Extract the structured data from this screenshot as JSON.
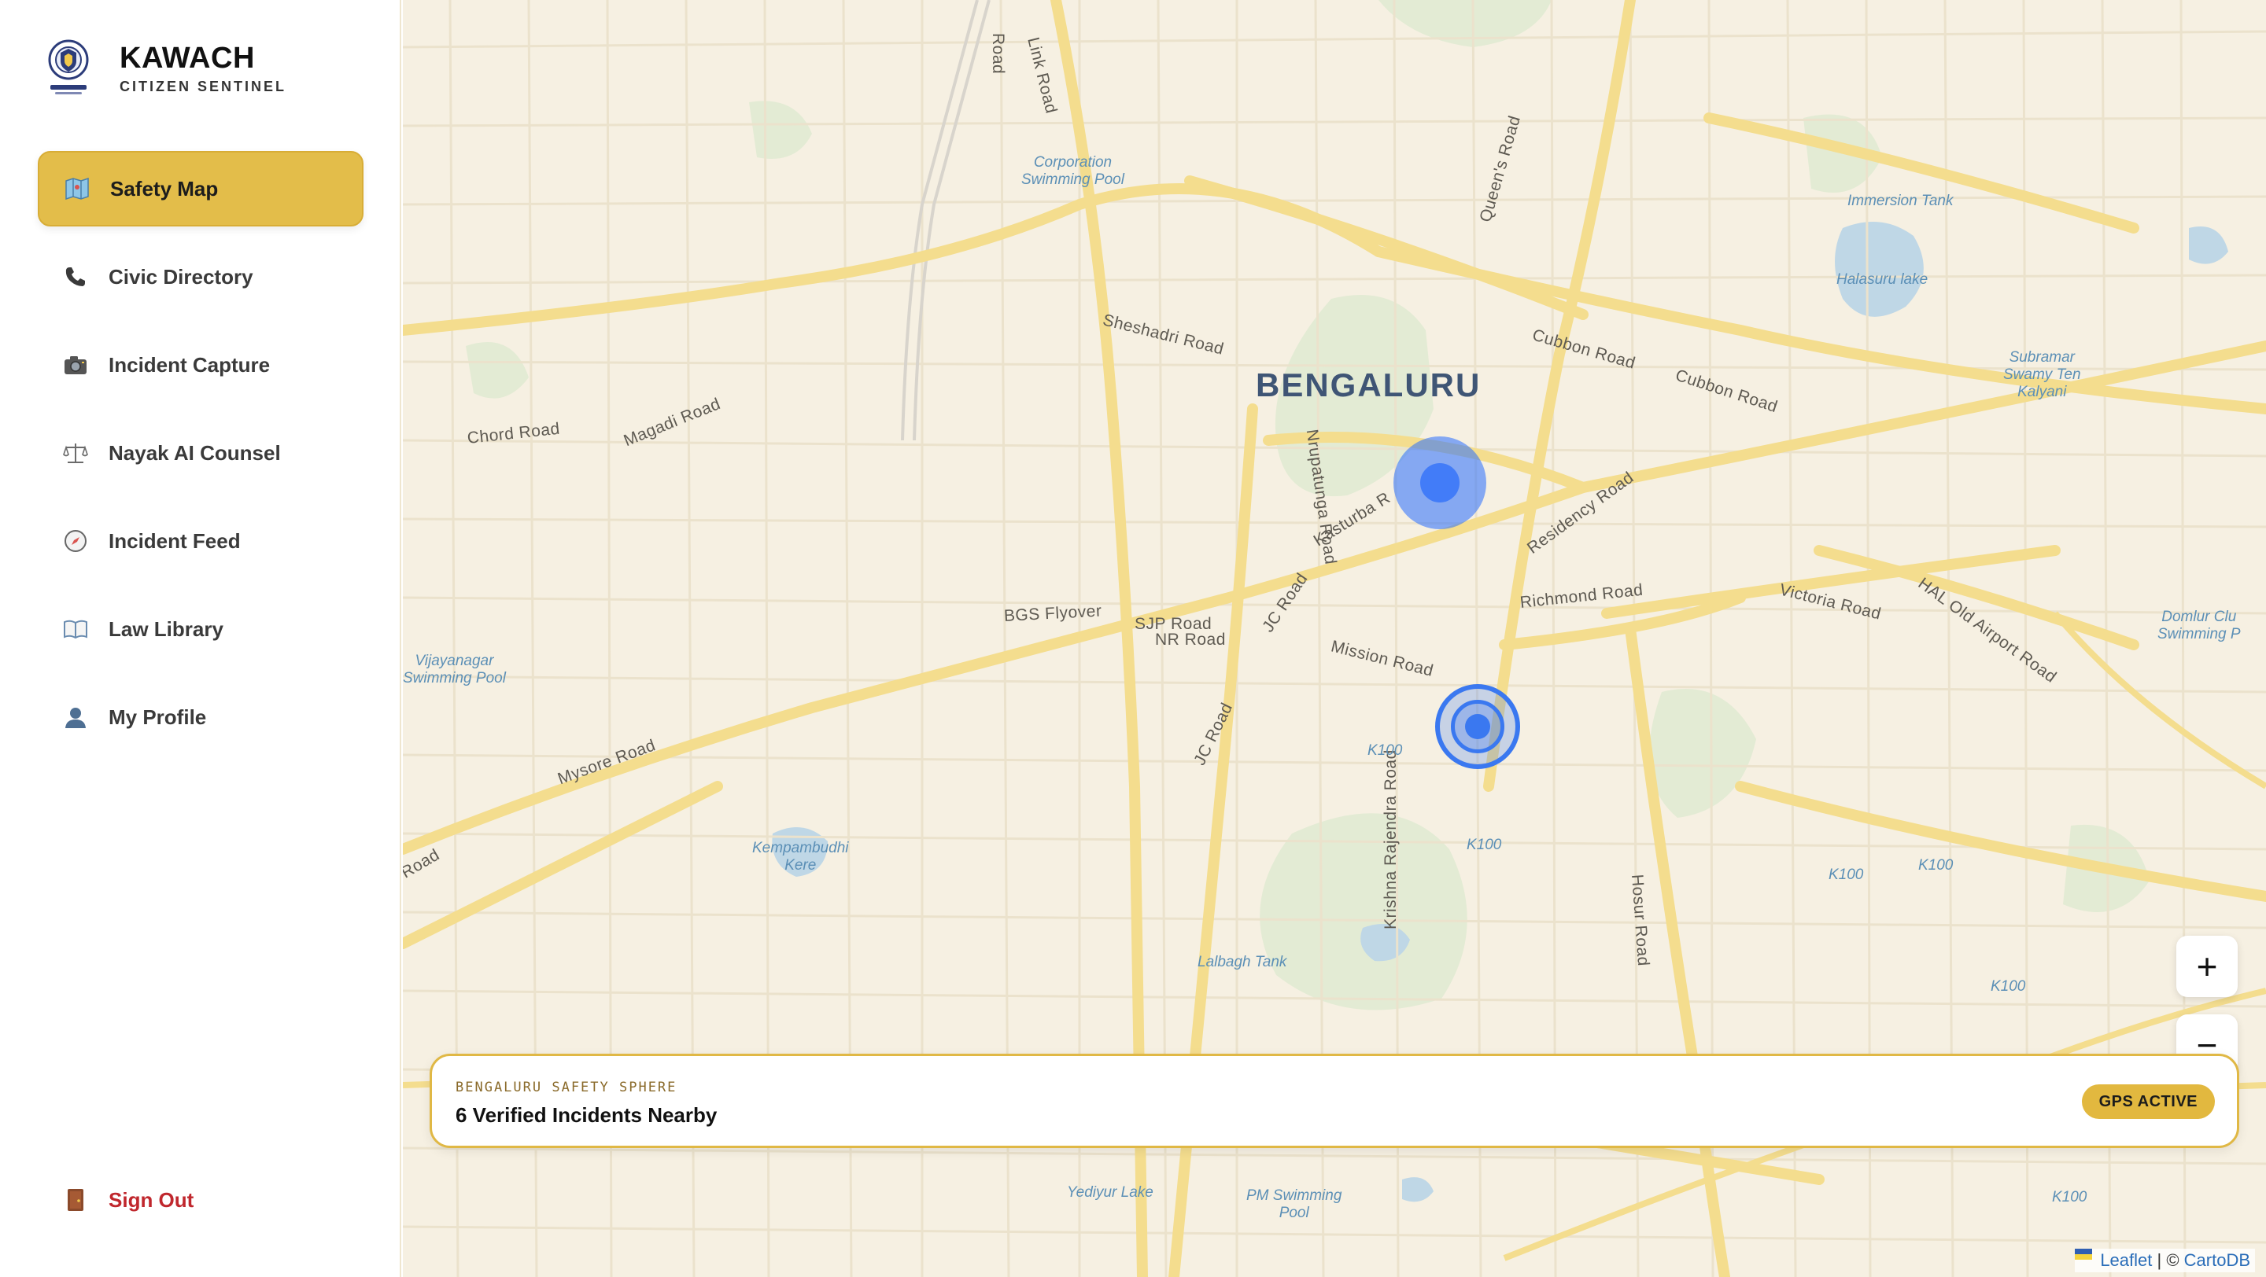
{
  "brand": {
    "title": "KAWACH",
    "subtitle": "CITIZEN SENTINEL",
    "logo_icon": "kawach-shield-logo"
  },
  "nav": {
    "items": [
      {
        "label": "Safety Map",
        "icon": "map-icon",
        "active": true
      },
      {
        "label": "Civic Directory",
        "icon": "phone-icon"
      },
      {
        "label": "Incident Capture",
        "icon": "camera-icon"
      },
      {
        "label": "Nayak AI Counsel",
        "icon": "scales-icon"
      },
      {
        "label": "Incident Feed",
        "icon": "compass-icon"
      },
      {
        "label": "Law Library",
        "icon": "book-icon"
      },
      {
        "label": "My Profile",
        "icon": "user-icon"
      }
    ],
    "signout": {
      "label": "Sign Out",
      "icon": "door-icon"
    }
  },
  "map": {
    "city": "BENGALURU",
    "roads": [
      "Sheshadri Road",
      "Cubbon Road",
      "Cubbon Road",
      "Chord Road",
      "Magadi Road",
      "Nrupatunga Road",
      "Kasturba R",
      "Residency Road",
      "Richmond Road",
      "Victoria Road",
      "HAL Old Airport Road",
      "BGS Flyover",
      "SJP Road",
      "NR Road",
      "JC Road",
      "JC Road",
      "Mission Road",
      "Mysore Road",
      "Krishna Rajendra Road",
      "Hosur Road",
      "Queen's Road",
      "Link Road",
      "Road",
      "Road"
    ],
    "water": [
      "Corporation\nSwimming Pool",
      "Immersion Tank",
      "Halasuru lake",
      "Subramar\nSwamy Ten\nKalyani",
      "Vijayanagar\nSwimming Pool",
      "Kempambudhi\nKere",
      "Lalbagh Tank",
      "Yediyur Lake",
      "PM Swimming\nPool",
      "Domlur Clu\nSwimming P"
    ],
    "highway": "K100",
    "zoom_in": "+",
    "zoom_out": "−"
  },
  "info": {
    "kicker": "BENGALURU SAFETY SPHERE",
    "title": "6 Verified Incidents Nearby",
    "badge": "GPS ACTIVE"
  },
  "attribution": {
    "leaflet": "Leaflet",
    "separator": " | © ",
    "carto": "CartoDB"
  },
  "colors": {
    "accent": "#e3bd4a",
    "signout": "#c0272d",
    "marker": "#3a78f0"
  }
}
